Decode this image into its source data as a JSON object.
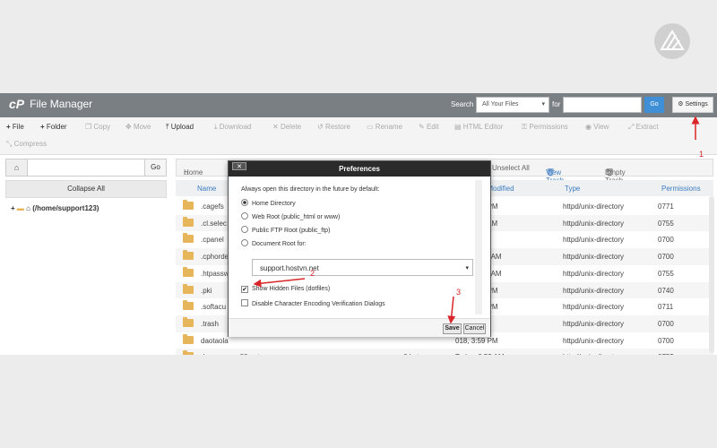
{
  "header": {
    "app_title": "File Manager",
    "search_label": "Search",
    "search_scope": "All Your Files",
    "for_label": "for",
    "go_label": "Go",
    "settings_label": "Settings"
  },
  "toolbar": {
    "file": "File",
    "folder": "Folder",
    "copy": "Copy",
    "move": "Move",
    "upload": "Upload",
    "download": "Download",
    "delete": "Delete",
    "restore": "Restore",
    "rename": "Rename",
    "edit": "Edit",
    "html_editor": "HTML Editor",
    "permissions": "Permissions",
    "view": "View",
    "extract": "Extract",
    "compress": "Compress"
  },
  "left_pane": {
    "go_label": "Go",
    "collapse_all": "Collapse All",
    "tree_root": "(/home/support123)"
  },
  "right_nav": {
    "home": "Home",
    "unselect_all": "Unselect All",
    "view_trash": "View Trash",
    "empty_trash": "Empty Trash"
  },
  "table": {
    "columns": {
      "name": "Name",
      "modified": "Last Modified",
      "type": "Type",
      "permissions": "Permissions"
    },
    "rows": [
      {
        "name": ".cagefs",
        "size": "",
        "modified": "018, 4:24 PM",
        "type": "httpd/unix-directory",
        "perms": "0771"
      },
      {
        "name": ".cl.selec",
        "size": "",
        "modified": "018, 3:50 AM",
        "type": "httpd/unix-directory",
        "perms": "0755"
      },
      {
        "name": ".cpanel",
        "size": "",
        "modified": "03 AM",
        "type": "httpd/unix-directory",
        "perms": "0700"
      },
      {
        "name": ".cphorde",
        "size": "",
        "modified": "018, 10:02 AM",
        "type": "httpd/unix-directory",
        "perms": "0700"
      },
      {
        "name": ".htpassw",
        "size": "",
        "modified": "018, 10:02 AM",
        "type": "httpd/unix-directory",
        "perms": "0755"
      },
      {
        "name": ".pki",
        "size": "",
        "modified": "018, 4:17 PM",
        "type": "httpd/unix-directory",
        "perms": "0740"
      },
      {
        "name": ".softacu",
        "size": "",
        "modified": "018, 4:24 PM",
        "type": "httpd/unix-directory",
        "perms": "0711"
      },
      {
        "name": ".trash",
        "size": "",
        "modified": "55 AM",
        "type": "httpd/unix-directory",
        "perms": "0700"
      },
      {
        "name": "daotaola",
        "size": "",
        "modified": "018, 3:59 PM",
        "type": "httpd/unix-directory",
        "perms": "0700"
      },
      {
        "name": "demo.sanvu88.net",
        "size": "6 bytes",
        "modified": "Today, 8:59 AM",
        "type": "httpd/unix-directory",
        "perms": "0755"
      }
    ]
  },
  "dialog": {
    "title": "Preferences",
    "close_label": "✕",
    "intro": "Always open this directory in the future by default:",
    "options": [
      "Home Directory",
      "Web Root (public_html or www)",
      "Public FTP Root (public_ftp)",
      "Document Root for:"
    ],
    "selected_option": "Home Directory",
    "document_root_value": "support.hostvn.net",
    "show_hidden": "Show Hidden Files (dotfiles)",
    "show_hidden_checked": true,
    "disable_encoding": "Disable Character Encoding Verification Dialogs",
    "disable_encoding_checked": false,
    "save_label": "Save",
    "cancel_label": "Cancel"
  },
  "annotations": {
    "step1": "1",
    "step2": "2",
    "step3": "3",
    "color": "#d9262b"
  },
  "colors": {
    "header_bg": "#7a7f84",
    "go_button": "#3e8fd6",
    "link_blue": "#3e7cbf",
    "folder": "#e8b65a"
  }
}
